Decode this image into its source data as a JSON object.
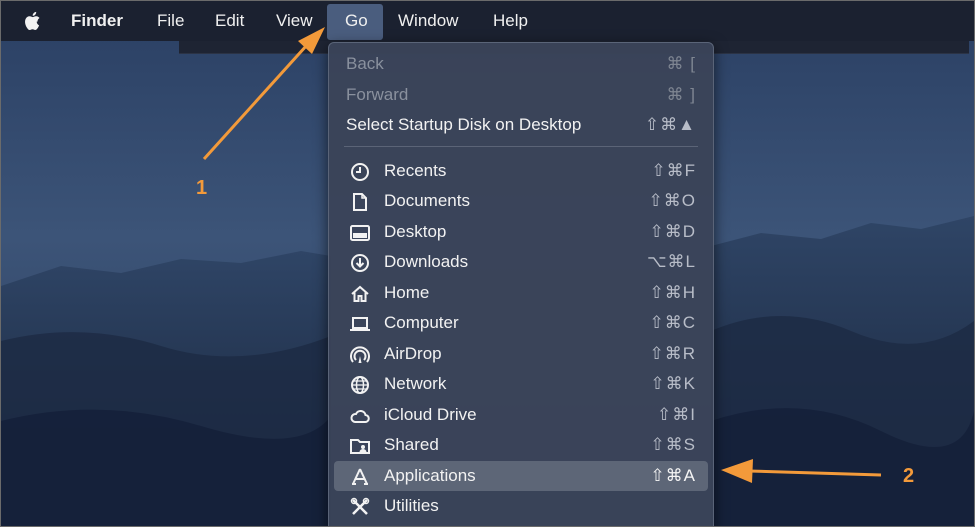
{
  "menubar": {
    "items": [
      {
        "label": "Finder",
        "bold": true
      },
      {
        "label": "File"
      },
      {
        "label": "Edit"
      },
      {
        "label": "View"
      },
      {
        "label": "Go"
      },
      {
        "label": "Window"
      },
      {
        "label": "Help"
      }
    ]
  },
  "go_menu": {
    "items": [
      {
        "label": "Back",
        "shortcut": "⌘ [",
        "icon": "",
        "disabled": true
      },
      {
        "label": "Forward",
        "shortcut": "⌘ ]",
        "icon": "",
        "disabled": true
      },
      {
        "label": "Select Startup Disk on Desktop",
        "shortcut": "⇧⌘▲",
        "icon": ""
      },
      {
        "label": "Recents",
        "shortcut": "⇧⌘F",
        "icon": "clock-icon"
      },
      {
        "label": "Documents",
        "shortcut": "⇧⌘O",
        "icon": "document-icon"
      },
      {
        "label": "Desktop",
        "shortcut": "⇧⌘D",
        "icon": "desktop-icon"
      },
      {
        "label": "Downloads",
        "shortcut": "⌥⌘L",
        "icon": "download-icon"
      },
      {
        "label": "Home",
        "shortcut": "⇧⌘H",
        "icon": "home-icon"
      },
      {
        "label": "Computer",
        "shortcut": "⇧⌘C",
        "icon": "laptop-icon"
      },
      {
        "label": "AirDrop",
        "shortcut": "⇧⌘R",
        "icon": "airdrop-icon"
      },
      {
        "label": "Network",
        "shortcut": "⇧⌘K",
        "icon": "globe-icon"
      },
      {
        "label": "iCloud Drive",
        "shortcut": "⇧⌘I",
        "icon": "cloud-icon"
      },
      {
        "label": "Shared",
        "shortcut": "⇧⌘S",
        "icon": "shared-folder-icon"
      },
      {
        "label": "Applications",
        "shortcut": "⇧⌘A",
        "icon": "applications-icon",
        "highlighted": true
      },
      {
        "label": "Utilities",
        "shortcut": "",
        "icon": "utilities-icon"
      }
    ]
  },
  "annotations": {
    "step1": "1",
    "step2": "2",
    "color": "#f39a3a"
  },
  "colors": {
    "menubar": "#1b2130",
    "menu_bg": "#3a4458",
    "highlight": "#5d6677"
  }
}
